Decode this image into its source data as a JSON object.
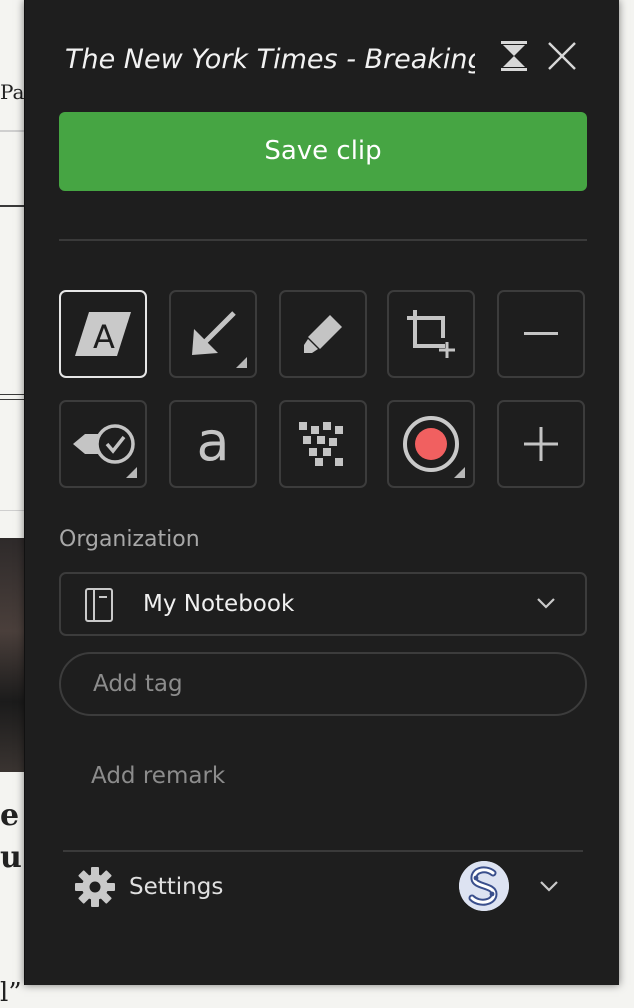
{
  "background_page": {
    "text_fragments": [
      "Pap",
      "e",
      "u",
      "l”"
    ]
  },
  "clipper": {
    "page_title": "The New York Times - Breaking News, US News, World News and Videos",
    "save_label": "Save clip",
    "tools": [
      {
        "name": "text-clip-tool",
        "icon": "article-icon",
        "selected": true
      },
      {
        "name": "arrow-tool",
        "icon": "arrow-icon",
        "selected": false
      },
      {
        "name": "highlighter-tool",
        "icon": "highlighter-icon",
        "selected": false
      },
      {
        "name": "crop-tool",
        "icon": "crop-icon",
        "selected": false
      },
      {
        "name": "zoom-out-tool",
        "icon": "minus-icon",
        "selected": false
      },
      {
        "name": "stamp-tool",
        "icon": "stamp-check-icon",
        "selected": false
      },
      {
        "name": "text-tool",
        "icon": "text-a-icon",
        "selected": false
      },
      {
        "name": "pixelate-tool",
        "icon": "pixelate-icon",
        "selected": false
      },
      {
        "name": "record-tool",
        "icon": "record-icon",
        "selected": false
      },
      {
        "name": "zoom-in-tool",
        "icon": "plus-icon",
        "selected": false
      }
    ],
    "organization_label": "Organization",
    "notebook": "My Notebook",
    "tag_placeholder": "Add tag",
    "remark_placeholder": "Add remark",
    "settings_label": "Settings"
  },
  "colors": {
    "panel_bg": "#1e1e1e",
    "save_green": "#46a543",
    "record_red": "#f16060"
  }
}
